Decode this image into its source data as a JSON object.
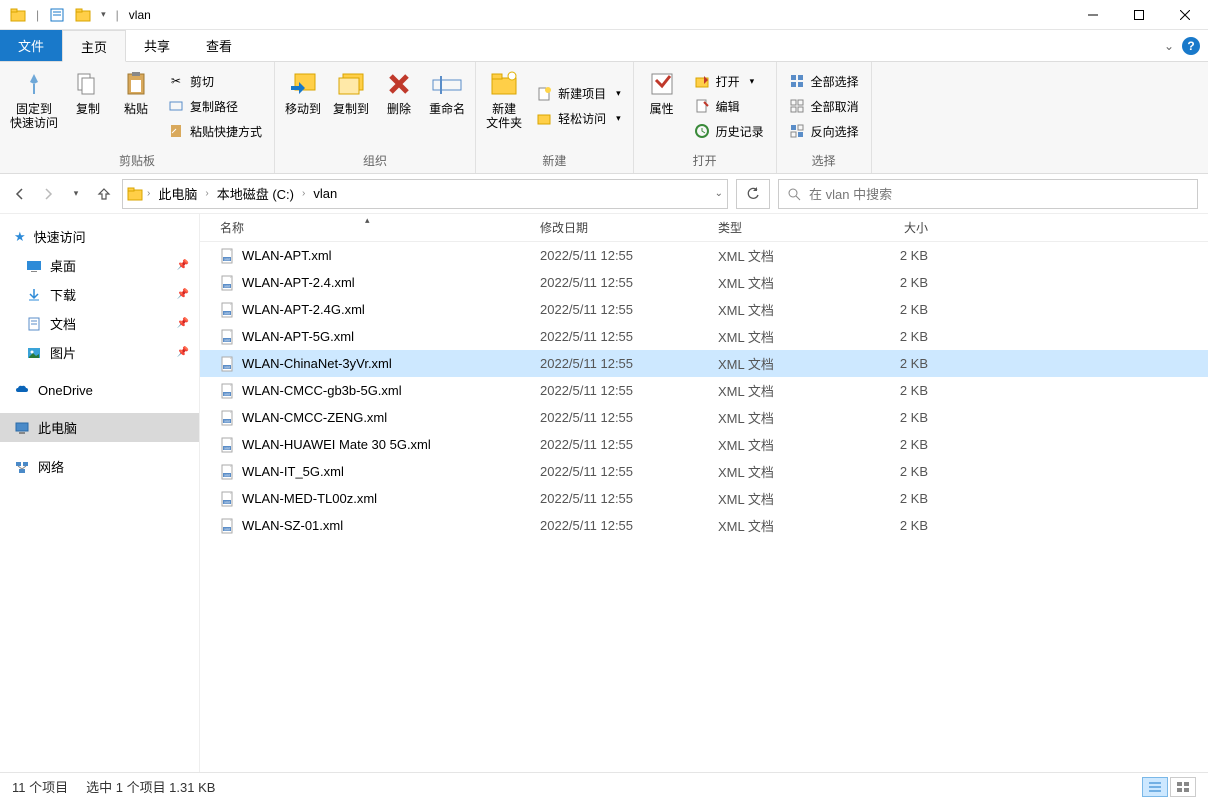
{
  "window": {
    "title": "vlan",
    "qat_sep": "|"
  },
  "tabs": {
    "file": "文件",
    "home": "主页",
    "share": "共享",
    "view": "查看"
  },
  "ribbon": {
    "clipboard": {
      "label": "剪贴板",
      "pin": "固定到\n快速访问",
      "copy": "复制",
      "paste": "粘贴",
      "cut": "剪切",
      "copy_path": "复制路径",
      "paste_shortcut": "粘贴快捷方式"
    },
    "organize": {
      "label": "组织",
      "move_to": "移动到",
      "copy_to": "复制到",
      "delete": "删除",
      "rename": "重命名"
    },
    "new": {
      "label": "新建",
      "new_folder": "新建\n文件夹",
      "new_item": "新建项目",
      "easy_access": "轻松访问"
    },
    "open": {
      "label": "打开",
      "properties": "属性",
      "open": "打开",
      "edit": "编辑",
      "history": "历史记录"
    },
    "select": {
      "label": "选择",
      "select_all": "全部选择",
      "select_none": "全部取消",
      "invert": "反向选择"
    }
  },
  "address": {
    "root": "此电脑",
    "drive": "本地磁盘 (C:)",
    "folder": "vlan",
    "search_placeholder": "在 vlan 中搜索"
  },
  "nav": {
    "quick_access": "快速访问",
    "desktop": "桌面",
    "downloads": "下载",
    "documents": "文档",
    "pictures": "图片",
    "onedrive": "OneDrive",
    "this_pc": "此电脑",
    "network": "网络"
  },
  "columns": {
    "name": "名称",
    "date": "修改日期",
    "type": "类型",
    "size": "大小"
  },
  "files": [
    {
      "name": "WLAN-APT.xml",
      "date": "2022/5/11 12:55",
      "type": "XML 文档",
      "size": "2 KB",
      "selected": false
    },
    {
      "name": "WLAN-APT-2.4.xml",
      "date": "2022/5/11 12:55",
      "type": "XML 文档",
      "size": "2 KB",
      "selected": false
    },
    {
      "name": "WLAN-APT-2.4G.xml",
      "date": "2022/5/11 12:55",
      "type": "XML 文档",
      "size": "2 KB",
      "selected": false
    },
    {
      "name": "WLAN-APT-5G.xml",
      "date": "2022/5/11 12:55",
      "type": "XML 文档",
      "size": "2 KB",
      "selected": false
    },
    {
      "name": "WLAN-ChinaNet-3yVr.xml",
      "date": "2022/5/11 12:55",
      "type": "XML 文档",
      "size": "2 KB",
      "selected": true
    },
    {
      "name": "WLAN-CMCC-gb3b-5G.xml",
      "date": "2022/5/11 12:55",
      "type": "XML 文档",
      "size": "2 KB",
      "selected": false
    },
    {
      "name": "WLAN-CMCC-ZENG.xml",
      "date": "2022/5/11 12:55",
      "type": "XML 文档",
      "size": "2 KB",
      "selected": false
    },
    {
      "name": "WLAN-HUAWEI Mate 30 5G.xml",
      "date": "2022/5/11 12:55",
      "type": "XML 文档",
      "size": "2 KB",
      "selected": false
    },
    {
      "name": "WLAN-IT_5G.xml",
      "date": "2022/5/11 12:55",
      "type": "XML 文档",
      "size": "2 KB",
      "selected": false
    },
    {
      "name": "WLAN-MED-TL00z.xml",
      "date": "2022/5/11 12:55",
      "type": "XML 文档",
      "size": "2 KB",
      "selected": false
    },
    {
      "name": "WLAN-SZ-01.xml",
      "date": "2022/5/11 12:55",
      "type": "XML 文档",
      "size": "2 KB",
      "selected": false
    }
  ],
  "status": {
    "items": "11 个项目",
    "selected": "选中 1 个项目  1.31 KB"
  }
}
